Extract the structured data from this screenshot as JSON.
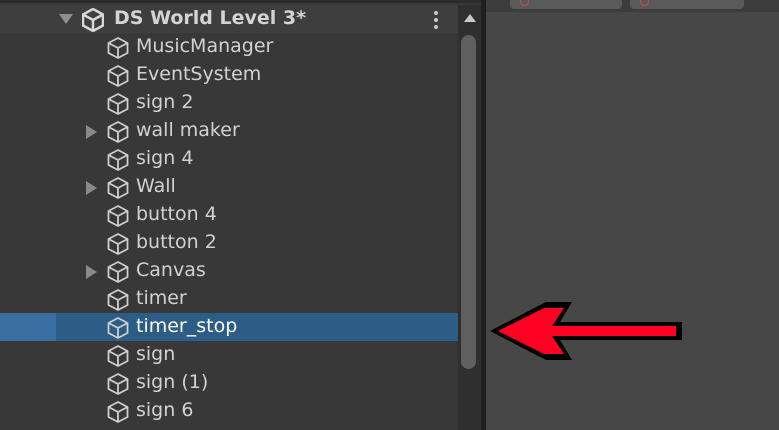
{
  "scene": {
    "title": "DS World Level 3*",
    "icon": "unity-logo-icon",
    "menu_icon": "kebab-menu-icon"
  },
  "hierarchy": {
    "items": [
      {
        "label": "MusicManager",
        "has_children": false,
        "selected": false
      },
      {
        "label": "EventSystem",
        "has_children": false,
        "selected": false
      },
      {
        "label": "sign 2",
        "has_children": false,
        "selected": false
      },
      {
        "label": "wall maker",
        "has_children": true,
        "selected": false
      },
      {
        "label": "sign 4",
        "has_children": false,
        "selected": false
      },
      {
        "label": "Wall",
        "has_children": true,
        "selected": false
      },
      {
        "label": "button 4",
        "has_children": false,
        "selected": false
      },
      {
        "label": "button 2",
        "has_children": false,
        "selected": false
      },
      {
        "label": "Canvas",
        "has_children": true,
        "selected": false
      },
      {
        "label": "timer",
        "has_children": false,
        "selected": false
      },
      {
        "label": "timer_stop",
        "has_children": false,
        "selected": true
      },
      {
        "label": "sign",
        "has_children": false,
        "selected": false
      },
      {
        "label": "sign (1)",
        "has_children": false,
        "selected": false
      },
      {
        "label": "sign 6",
        "has_children": false,
        "selected": false
      }
    ]
  },
  "annotation": {
    "icon": "red-arrow-left-icon",
    "color": "#ff0022"
  },
  "colors": {
    "panel_bg": "#383838",
    "selection": "#2c5d87",
    "text": "#d2d2d2"
  }
}
